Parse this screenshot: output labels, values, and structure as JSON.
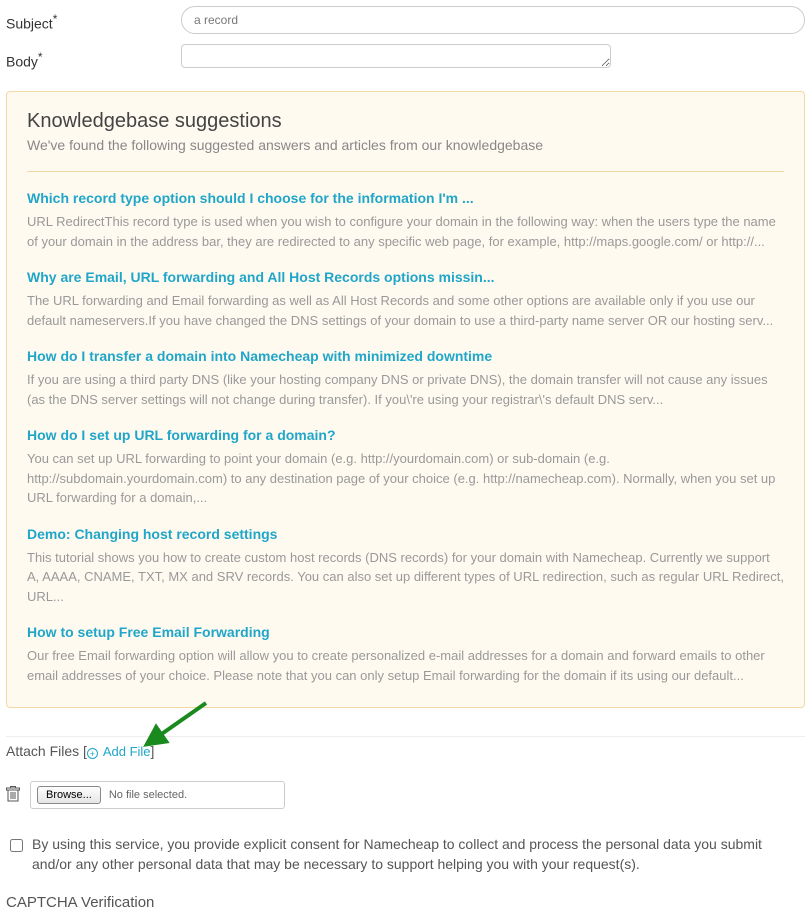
{
  "form": {
    "subject_label": "Subject",
    "subject_value": "a record",
    "body_label": "Body"
  },
  "kb": {
    "title": "Knowledgebase suggestions",
    "subtitle": "We've found the following suggested answers and articles from our knowledgebase",
    "items": [
      {
        "title": "Which record type option should I choose for the information I'm ...",
        "excerpt": "URL RedirectThis record type is used when you wish to configure your domain in the following way: when the users type the name of your domain in the address bar, they are redirected to any specific web page, for example, http://maps.google.com/ or http://..."
      },
      {
        "title": "Why are Email, URL forwarding and All Host Records options missin...",
        "excerpt": "The URL forwarding and Email forwarding as well as All Host Records and some other options are available only if you use our default nameservers.If you have changed the DNS settings of your domain to use a third-party name server OR our hosting serv..."
      },
      {
        "title": "How do I transfer a domain into Namecheap with minimized downtime",
        "excerpt": "If you are using a third party DNS (like your hosting company DNS or private DNS), the domain transfer will not cause any issues (as the DNS server settings will not change during transfer). If you\\'re using your registrar\\'s default DNS serv..."
      },
      {
        "title": "How do I set up URL forwarding for a domain?",
        "excerpt": "You can set up URL forwarding to point your domain (e.g. http://yourdomain.com) or sub-domain (e.g. http://subdomain.yourdomain.com) to any destination page of your choice (e.g. http://namecheap.com). Normally, when you set up URL forwarding for a domain,..."
      },
      {
        "title": "Demo: Changing host record settings",
        "excerpt": "This tutorial shows you how to create custom host records (DNS records) for your domain with Namecheap. Currently we support A, AAAA, CNAME, TXT, MX and SRV records. You can also set up different types of URL redirection, such as regular URL Redirect, URL..."
      },
      {
        "title": "How to setup Free Email Forwarding",
        "excerpt": "Our free Email forwarding option will allow you to create personalized e-mail addresses for a domain and forward emails to other email addresses of your choice. Please note that you can only setup Email forwarding for the domain if its using our default..."
      }
    ]
  },
  "attach": {
    "label": "Attach Files",
    "add_file": "Add File",
    "browse": "Browse...",
    "no_file": "No file selected."
  },
  "consent": {
    "text": "By using this service, you provide explicit consent for Namecheap to collect and process the personal data you submit and/or any other personal data that may be necessary to support helping you with your request(s)."
  },
  "captcha": {
    "title": "CAPTCHA Verification"
  }
}
